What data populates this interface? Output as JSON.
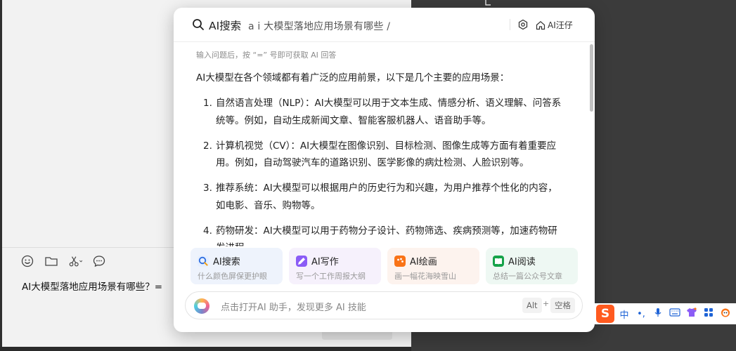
{
  "background_app": {
    "toolbar": [
      {
        "name": "emoji-icon",
        "glyph": "☺"
      },
      {
        "name": "folder-icon",
        "glyph": ""
      },
      {
        "name": "scissors-icon",
        "glyph": "✂"
      },
      {
        "name": "chat-bubble-icon",
        "glyph": ""
      }
    ],
    "input_text": "AI大模型落地应用场景有哪些？="
  },
  "panel": {
    "brand": "AI搜索",
    "query": "a i 大模型落地应用场景有哪些 /",
    "home_label": "AI汪仔",
    "hint": "输入问题后，按 “=” 号即可获取 AI 回答",
    "intro": "AI大模型在各个领域都有着广泛的应用前景，以下是几个主要的应用场景：",
    "items": [
      {
        "num": "1.",
        "text": "自然语言处理（NLP）：AI大模型可以用于文本生成、情感分析、语义理解、问答系统等。例如，自动生成新闻文章、智能客服机器人、语音助手等。"
      },
      {
        "num": "2.",
        "text": "计算机视觉（CV）：AI大模型在图像识别、目标检测、图像生成等方面有着重要应用。例如，自动驾驶汽车的道路识别、医学影像的病灶检测、人脸识别等。"
      },
      {
        "num": "3.",
        "text": "推荐系统：AI大模型可以根据用户的历史行为和兴趣，为用户推荐个性化的内容，如电影、音乐、购物等。"
      },
      {
        "num": "4.",
        "text": "药物研发：AI大模型可以用于药物分子设计、药物筛选、疾病预测等，加速药物研发进程。"
      }
    ],
    "cards": [
      {
        "title": "AI搜索",
        "sub": "什么颜色屏保更护眼",
        "bg": "#eef3fc",
        "icon_bg": "#e6efff",
        "icon_color": "#2f6fe0",
        "icon": "search-icon"
      },
      {
        "title": "AI写作",
        "sub": "写一个工作周报大纲",
        "bg": "#f6f1fc",
        "icon_bg": "#8b5cf6",
        "icon_color": "#ffffff",
        "icon": "pen-icon"
      },
      {
        "title": "AI绘画",
        "sub": "画一幅花海映雪山",
        "bg": "#fdf3ee",
        "icon_bg": "#f97316",
        "icon_color": "#ffffff",
        "icon": "palette-icon"
      },
      {
        "title": "AI阅读",
        "sub": "总结一篇公众号文章",
        "bg": "#eef8f3",
        "icon_bg": "#16a34a",
        "icon_color": "#ffffff",
        "icon": "book-icon"
      }
    ],
    "bottom_placeholder": "点击打开AI 助手，发现更多 AI 技能",
    "key_alt": "Alt",
    "key_plus": "+",
    "key_space": "空格"
  },
  "ime": {
    "logo": "S",
    "items": [
      {
        "name": "chinese-mode-icon",
        "glyph": "中"
      },
      {
        "name": "punctuation-icon",
        "glyph": "•,"
      },
      {
        "name": "microphone-icon",
        "glyph": "🎤"
      },
      {
        "name": "keyboard-icon",
        "glyph": "⌨"
      },
      {
        "name": "skin-icon",
        "glyph": "👕"
      },
      {
        "name": "apps-grid-icon",
        "glyph": "▦"
      },
      {
        "name": "mascot-icon",
        "glyph": "🐶"
      }
    ]
  }
}
